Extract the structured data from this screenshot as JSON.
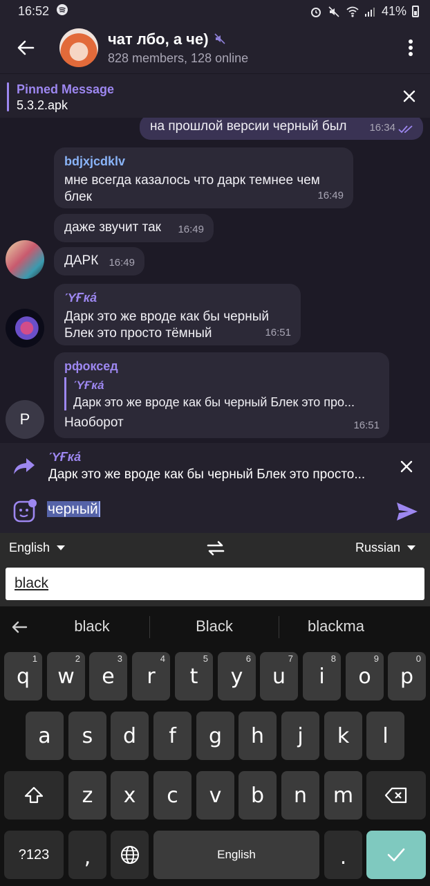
{
  "status": {
    "time": "16:52",
    "battery": "41%"
  },
  "header": {
    "title": "чат лбо, а че)",
    "subtitle": "828 members, 128 online"
  },
  "pinned": {
    "label": "Pinned Message",
    "text": "5.3.2.apk"
  },
  "messages": {
    "m1": {
      "text": "на прошлой версии черный был",
      "time": "16:34"
    },
    "m2": {
      "sender": "bdjxjcdklv",
      "text": "мне всегда казалось что дарк темнее чем блек",
      "time": "16:49"
    },
    "m3": {
      "text": "даже звучит так",
      "time": "16:49"
    },
    "m4": {
      "text": "ДАРК",
      "time": "16:49"
    },
    "m5": {
      "sender": "ΎҒка́",
      "line1": "Дарк это же вроде как бы черный",
      "line2": "Блек это просто тёмный",
      "time": "16:51"
    },
    "m6": {
      "sender": "рфоксед",
      "quote_name": "ΎҒка́",
      "quote_text": "Дарк это же вроде как бы черный  Блек это про...",
      "text": "Наоборот",
      "time": "16:51",
      "avatar_letter": "P"
    }
  },
  "reply": {
    "name": "ΎҒка́",
    "text": "Дарк это же вроде как бы черный  Блек это просто..."
  },
  "compose": {
    "text": "черный"
  },
  "translate": {
    "from": "English",
    "to": "Russian",
    "result": "black"
  },
  "keyboard": {
    "suggestions": [
      "black",
      "Black",
      "blackma"
    ],
    "row1": [
      "q",
      "w",
      "e",
      "r",
      "t",
      "y",
      "u",
      "i",
      "o",
      "p"
    ],
    "hints": [
      "1",
      "2",
      "3",
      "4",
      "5",
      "6",
      "7",
      "8",
      "9",
      "0"
    ],
    "row2": [
      "a",
      "s",
      "d",
      "f",
      "g",
      "h",
      "j",
      "k",
      "l"
    ],
    "row3": [
      "z",
      "x",
      "c",
      "v",
      "b",
      "n",
      "m"
    ],
    "symbols": "?123",
    "comma": ",",
    "space": "English",
    "period": "."
  },
  "colors": {
    "accent": "#9d87f0",
    "bg": "#1d1a26",
    "bubble": "#2c2937",
    "enter": "#7fc9bf"
  }
}
